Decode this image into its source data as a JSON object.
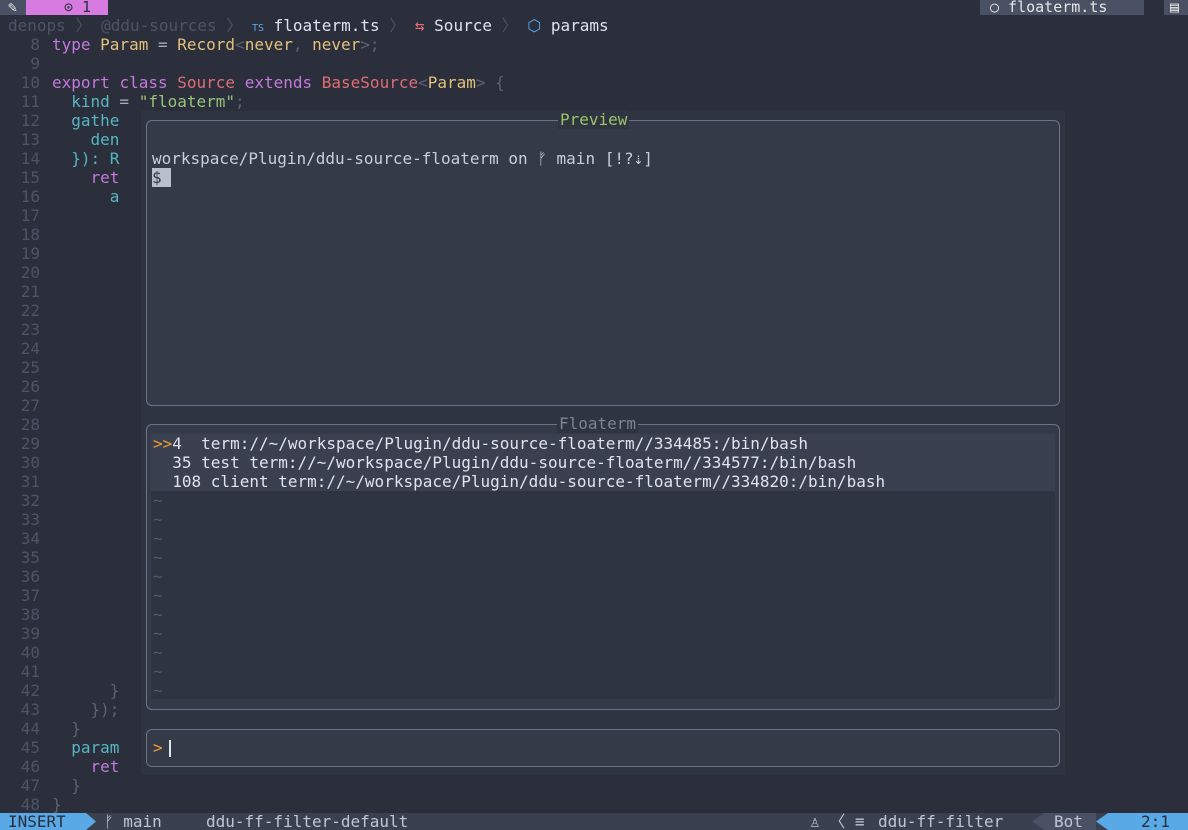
{
  "tabline": {
    "left_icon": "✎",
    "tab_number": "⊙ 1",
    "file_tab": "○ floaterm.ts",
    "file_icon": "▤"
  },
  "winbar": {
    "crumb1": "denops",
    "crumb2": "@ddu-sources",
    "crumb3_icon": "TS",
    "crumb3": "floaterm.ts",
    "crumb4_icon": "⇆",
    "crumb4": "Source",
    "crumb5_icon": "⬡",
    "crumb5": "params",
    "sep": " 〉 "
  },
  "code": {
    "lines": [
      {
        "n": "8"
      },
      {
        "n": "9"
      },
      {
        "n": "10"
      },
      {
        "n": "11"
      },
      {
        "n": "12"
      },
      {
        "n": "13"
      },
      {
        "n": "14"
      },
      {
        "n": "15"
      },
      {
        "n": "16"
      },
      {
        "n": "17"
      },
      {
        "n": "18"
      },
      {
        "n": "19"
      },
      {
        "n": "20"
      },
      {
        "n": "21"
      },
      {
        "n": "22"
      },
      {
        "n": "23"
      },
      {
        "n": "24"
      },
      {
        "n": "25"
      },
      {
        "n": "26"
      },
      {
        "n": "27"
      },
      {
        "n": "28"
      },
      {
        "n": "29"
      },
      {
        "n": "30"
      },
      {
        "n": "31"
      },
      {
        "n": "32"
      },
      {
        "n": "33"
      },
      {
        "n": "34"
      },
      {
        "n": "35"
      },
      {
        "n": "36"
      },
      {
        "n": "37"
      },
      {
        "n": "38"
      },
      {
        "n": "39"
      },
      {
        "n": "40"
      },
      {
        "n": "41"
      },
      {
        "n": "42"
      },
      {
        "n": "43"
      },
      {
        "n": "44"
      },
      {
        "n": "45"
      },
      {
        "n": "46"
      },
      {
        "n": "47"
      },
      {
        "n": "48"
      }
    ],
    "l8": {
      "kw": "type",
      "name": "Param",
      "eq": " = ",
      "rec": "Record",
      "lt": "<",
      "a": "never",
      "comma": ", ",
      "b": "never",
      "end": ">;"
    },
    "l10": {
      "kw1": "export",
      "kw2": "class",
      "name": "Source",
      "kw3": "extends",
      "base": "BaseSource",
      "lt": "<",
      "param": "Param",
      "end": "> {"
    },
    "l11": {
      "prop": "kind",
      "eq": " = ",
      "str": "\"floaterm\"",
      "end": ";"
    },
    "l12": "gathe",
    "l13": "den",
    "l14": "}): R",
    "l15": "ret",
    "l16": "a",
    "l42": "}",
    "l43": "});",
    "l44": "}",
    "l45": "param",
    "l46": "ret",
    "l47": "}",
    "l48": "}"
  },
  "preview": {
    "title": "Preview",
    "line1": "workspace/Plugin/ddu-source-floaterm on ᚠ main [!?⇣]",
    "prompt": "$ "
  },
  "floaterm": {
    "title": "Floaterm",
    "marker": ">>",
    "items": [
      "4  term://~/workspace/Plugin/ddu-source-floaterm//334485:/bin/bash",
      "35 test term://~/workspace/Plugin/ddu-source-floaterm//334577:/bin/bash",
      "108 client term://~/workspace/Plugin/ddu-source-floaterm//334820:/bin/bash"
    ],
    "empty_marker": "~"
  },
  "prompt": {
    "symbol": ">"
  },
  "statusline": {
    "mode": "INSERT",
    "branch": "ᚠ main",
    "name": "ddu-ff-filter-default",
    "icons": "♙ 〈 ≡",
    "filetype": "ddu-ff-filter",
    "position": "Bot",
    "line_col": "2:1"
  }
}
